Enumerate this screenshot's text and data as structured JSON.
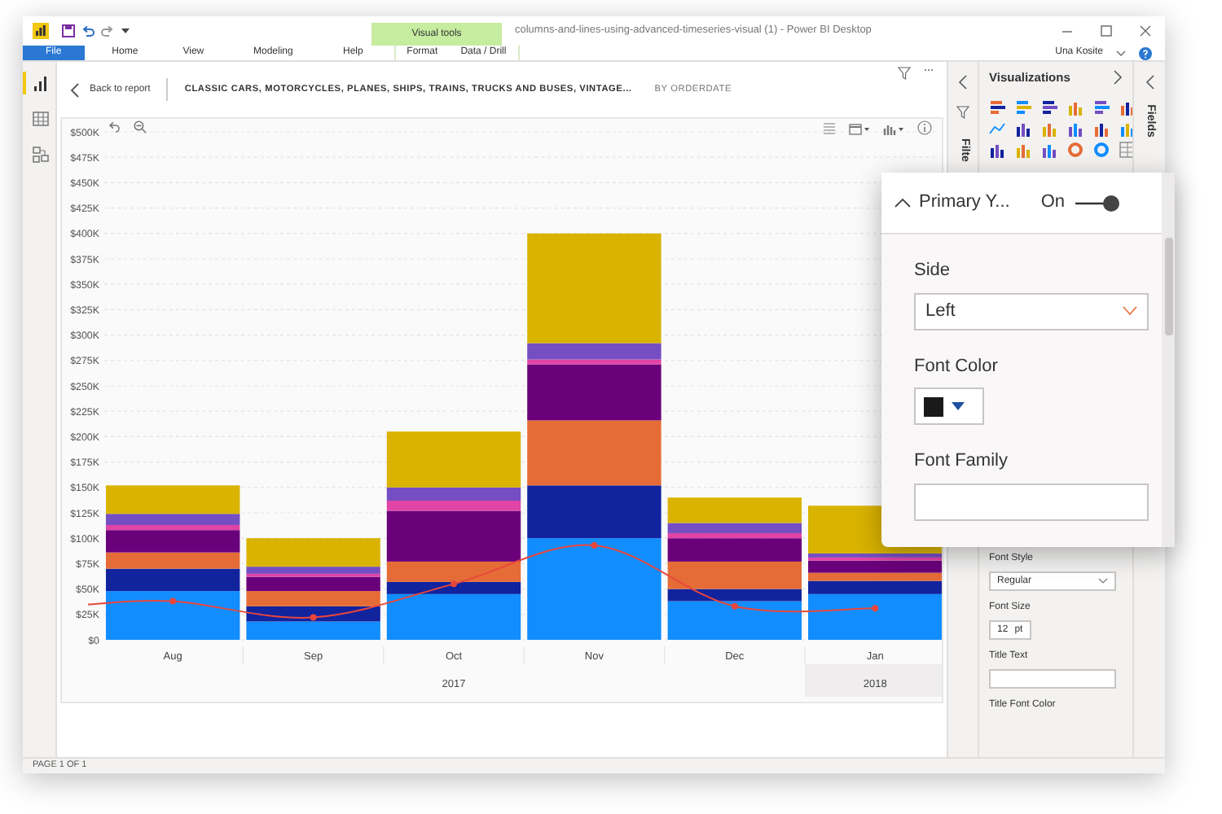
{
  "title_bar": {
    "title": "columns-and-lines-using-advanced-timeseries-visual (1) - Power BI Desktop",
    "contextual_group": "Visual tools",
    "user": "Una Kosite"
  },
  "ribbon_tabs": [
    {
      "label": "File",
      "kind": "file",
      "selected": true
    },
    {
      "label": "Home",
      "kind": "main",
      "selected": false
    },
    {
      "label": "View",
      "kind": "main",
      "selected": false
    },
    {
      "label": "Modeling",
      "kind": "main",
      "selected": false
    },
    {
      "label": "Help",
      "kind": "main",
      "selected": false
    },
    {
      "label": "Format",
      "kind": "contextual",
      "selected": false
    },
    {
      "label": "Data / Drill",
      "kind": "contextual",
      "selected": false
    }
  ],
  "left_rail": [
    {
      "kind": "report",
      "selected": true
    },
    {
      "kind": "data",
      "selected": false
    },
    {
      "kind": "model",
      "selected": false
    }
  ],
  "canvas": {
    "back_label": "Back to report",
    "more_label": "⋯",
    "chart_title": "CLASSIC CARS, MOTORCYCLES, PLANES, SHIPS, TRAINS, TRUCKS AND BUSES, VINTAGE...",
    "subtitle": "BY ORDERDATE",
    "chart_data": {
      "type": "bar",
      "stacked": true,
      "grid": true,
      "categories": [
        "Aug",
        "Sep",
        "Oct",
        "Nov",
        "Dec",
        "Jan"
      ],
      "ylim": [
        0,
        500000
      ],
      "yticks": [
        {
          "value": 0,
          "label": "$0"
        },
        {
          "value": 25000,
          "label": "$25K"
        },
        {
          "value": 50000,
          "label": "$50K"
        },
        {
          "value": 75000,
          "label": "$75K"
        },
        {
          "value": 100000,
          "label": "$100K"
        },
        {
          "value": 125000,
          "label": "$125K"
        },
        {
          "value": 150000,
          "label": "$150K"
        },
        {
          "value": 175000,
          "label": "$175K"
        },
        {
          "value": 200000,
          "label": "$200K"
        },
        {
          "value": 225000,
          "label": "$225K"
        },
        {
          "value": 250000,
          "label": "$250K"
        },
        {
          "value": 275000,
          "label": "$275K"
        },
        {
          "value": 300000,
          "label": "$300K"
        },
        {
          "value": 325000,
          "label": "$325K"
        },
        {
          "value": 350000,
          "label": "$350K"
        },
        {
          "value": 375000,
          "label": "$375K"
        },
        {
          "value": 400000,
          "label": "$400K"
        },
        {
          "value": 425000,
          "label": "$425K"
        },
        {
          "value": 450000,
          "label": "$450K"
        },
        {
          "value": 475000,
          "label": "$475K"
        },
        {
          "value": 500000,
          "label": "$500K"
        }
      ],
      "series": [
        {
          "color": "#118dff",
          "values": [
            48000,
            18000,
            45000,
            100000,
            38000,
            45000
          ]
        },
        {
          "color": "#12239e",
          "values": [
            22000,
            15000,
            12000,
            52000,
            12000,
            13000
          ]
        },
        {
          "color": "#e66c37",
          "values": [
            16000,
            15000,
            20000,
            64000,
            27000,
            8000
          ]
        },
        {
          "color": "#6b007b",
          "values": [
            22000,
            14000,
            50000,
            55000,
            23000,
            12000
          ]
        },
        {
          "color": "#e044a7",
          "values": [
            5000,
            3000,
            10000,
            5000,
            5000,
            3000
          ]
        },
        {
          "color": "#744ec2",
          "values": [
            11000,
            7000,
            13000,
            16000,
            10000,
            4000
          ]
        },
        {
          "color": "#d9b300",
          "values": [
            28000,
            28000,
            55000,
            108000,
            25000,
            47000
          ]
        },
        {
          "type": "line",
          "marker": "circle",
          "color": "#e8473b",
          "values": [
            38000,
            22000,
            55000,
            93000,
            33000,
            31000
          ]
        }
      ]
    },
    "year_groups": [
      {
        "label": "2017",
        "highlighted": false
      },
      {
        "label": "2018",
        "highlighted": true
      }
    ]
  },
  "status_bar": "PAGE 1 OF 1",
  "filters_pane": {
    "label": "Filte"
  },
  "visualizations_pane": {
    "title": "Visualizations",
    "format_fields": [
      {
        "kind": "dropdown",
        "label": "Font Style",
        "value": "Regular"
      },
      {
        "kind": "spinner",
        "label": "Font Size",
        "value": "12",
        "unit": "pt"
      },
      {
        "kind": "text",
        "label": "Title Text"
      },
      {
        "kind": "heading",
        "label": "Title Font Color"
      }
    ]
  },
  "fields_pane": {
    "label": "Fields"
  },
  "format_popup": {
    "section": "Primary Y...",
    "expanded": true,
    "toggle_label": "On",
    "on": true,
    "fields": [
      {
        "kind": "dropdown",
        "label": "Side",
        "value": "Left"
      },
      {
        "kind": "color",
        "label": "Font Color",
        "color": "#1a1a1a"
      },
      {
        "kind": "text",
        "label": "Font Family"
      }
    ]
  }
}
